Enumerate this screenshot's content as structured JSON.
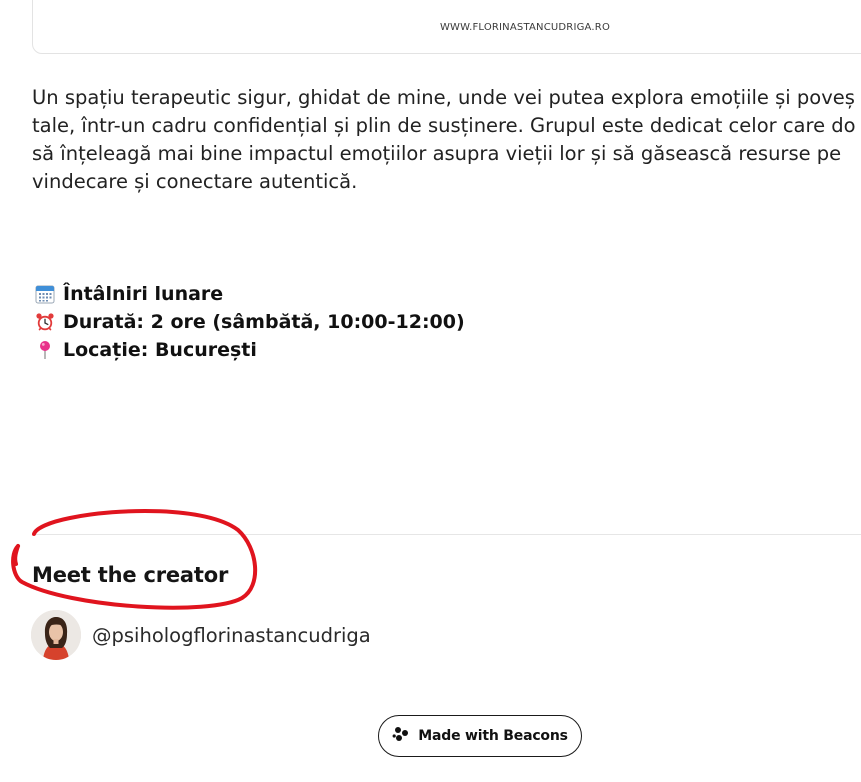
{
  "preview": {
    "url_text": "WWW.FLORINASTANCUDRIGA.RO"
  },
  "description": {
    "lines": [
      "Un spațiu terapeutic sigur, ghidat de mine, unde vei putea explora emoțiile și poveș",
      "tale, într-un cadru confidențial și plin de susținere. Grupul este dedicat celor care do",
      "să înțeleagă mai bine impactul emoțiilor asupra vieții lor și să găsească resurse pe",
      "vindecare și conectare autentică."
    ]
  },
  "details": {
    "items": [
      {
        "icon": "calendar-icon",
        "text": "Întâlniri lunare"
      },
      {
        "icon": "alarm-clock-icon",
        "text": "Durată: 2 ore (sâmbătă, 10:00-12:00)"
      },
      {
        "icon": "pushpin-icon",
        "text": "Locație: București"
      }
    ]
  },
  "creator": {
    "heading": "Meet the creator",
    "handle": "@psihologflorinastancudriga"
  },
  "footer": {
    "made_with_label": "Made with Beacons"
  },
  "colors": {
    "annotation_red": "#e0141e",
    "border": "#e3e3e3",
    "text": "#1f1f1f"
  }
}
